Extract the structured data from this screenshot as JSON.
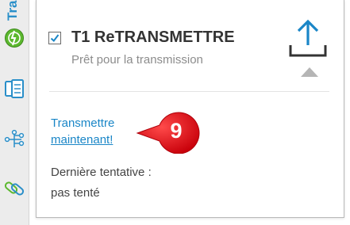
{
  "sidebar": {
    "active_tab_label": "Tra",
    "icons": [
      "transmission-status-icon",
      "documents-icon",
      "workflow-icon",
      "attachment-icon"
    ]
  },
  "card": {
    "checkbox_checked": true,
    "title": "T1 ReTRANSMETTRE",
    "subtitle": "Prêt pour la transmission",
    "link_line1": "Transmettre",
    "link_line2": "maintenant!",
    "callout_number": "9",
    "last_attempt_label": "Dernière tentative :",
    "last_attempt_value": "pas tenté"
  },
  "colors": {
    "accent": "#1a86c7",
    "success_green": "#5cb82e",
    "callout_red": "#e0101a"
  }
}
